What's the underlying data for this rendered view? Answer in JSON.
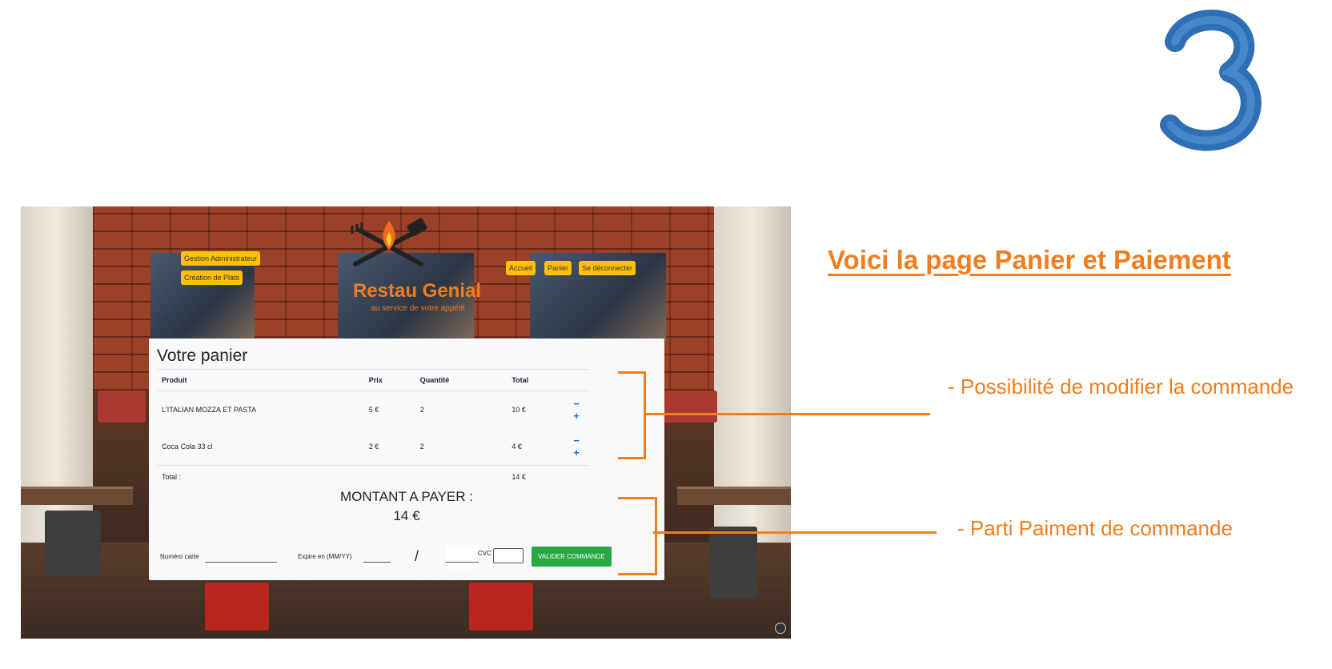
{
  "slide_number": "3",
  "heading": "Voici la page Panier et Paiement",
  "annotations": {
    "modify": "- Possibilité de modifier la  commande",
    "payment": "- Parti Paiment de commande"
  },
  "app": {
    "brand": "Restau Genial",
    "tagline": "au service de votre appétit",
    "admin_nav": [
      "Gestion Administrateur",
      "Création de Plats"
    ],
    "main_nav": [
      "Accueil",
      "Panier",
      "Se déconnecter"
    ]
  },
  "cart": {
    "title": "Votre panier",
    "columns": [
      "Produit",
      "Prix",
      "Quantité",
      "Total"
    ],
    "rows": [
      {
        "product": "L'ITALIAN MOZZA ET PASTA",
        "price": "5 €",
        "quantity": "2",
        "total": "10 €"
      },
      {
        "product": "Coca Cola 33 cl",
        "price": "2 €",
        "quantity": "2",
        "total": "4 €"
      }
    ],
    "total_label": "Total :",
    "total_value": "14 €",
    "minus_symbol": "−",
    "plus_symbol": "+"
  },
  "payment": {
    "amount_label": "MONTANT A PAYER :",
    "amount_value": "14 €",
    "card_label": "Numéro carte",
    "expiry_label": "Expire en (MM/YY)",
    "slash": "/",
    "cvc_label": "CVC",
    "submit_label": "VALIDER COMMANDE"
  },
  "colors": {
    "accent": "#f07d1e",
    "nav_button": "#ffc107",
    "submit": "#28a745",
    "qty_controls": "#0d6efd",
    "number_blue": "#3a7bbf"
  }
}
